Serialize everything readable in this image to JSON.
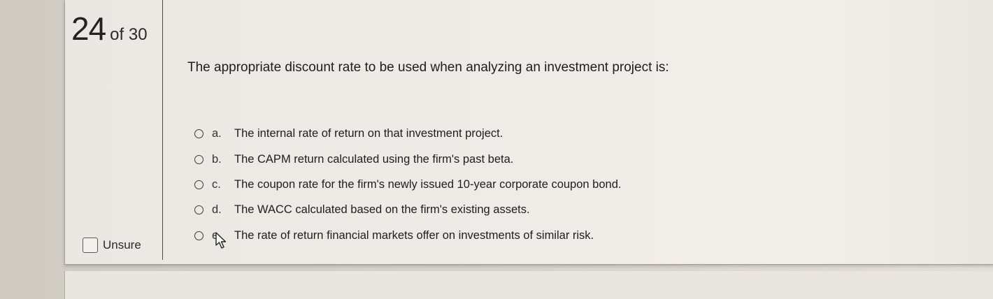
{
  "question_counter": {
    "current": "24",
    "total": "of 30"
  },
  "question": {
    "text": "The appropriate discount rate to be used when analyzing an investment project is:"
  },
  "options": [
    {
      "letter": "a.",
      "text": "The internal rate of return on that investment project."
    },
    {
      "letter": "b.",
      "text": "The CAPM return calculated using the firm's past beta."
    },
    {
      "letter": "c.",
      "text": "The coupon rate for the firm's newly issued 10-year corporate coupon bond."
    },
    {
      "letter": "d.",
      "text": "The WACC calculated based on the firm's existing assets."
    },
    {
      "letter": "e.",
      "text": "The rate of return financial markets offer on investments of similar risk."
    }
  ],
  "unsure": {
    "label": "Unsure",
    "checked": false
  },
  "icons": {
    "radio": "radio-button-icon",
    "checkbox": "checkbox-icon",
    "cursor": "mouse-pointer-icon"
  }
}
